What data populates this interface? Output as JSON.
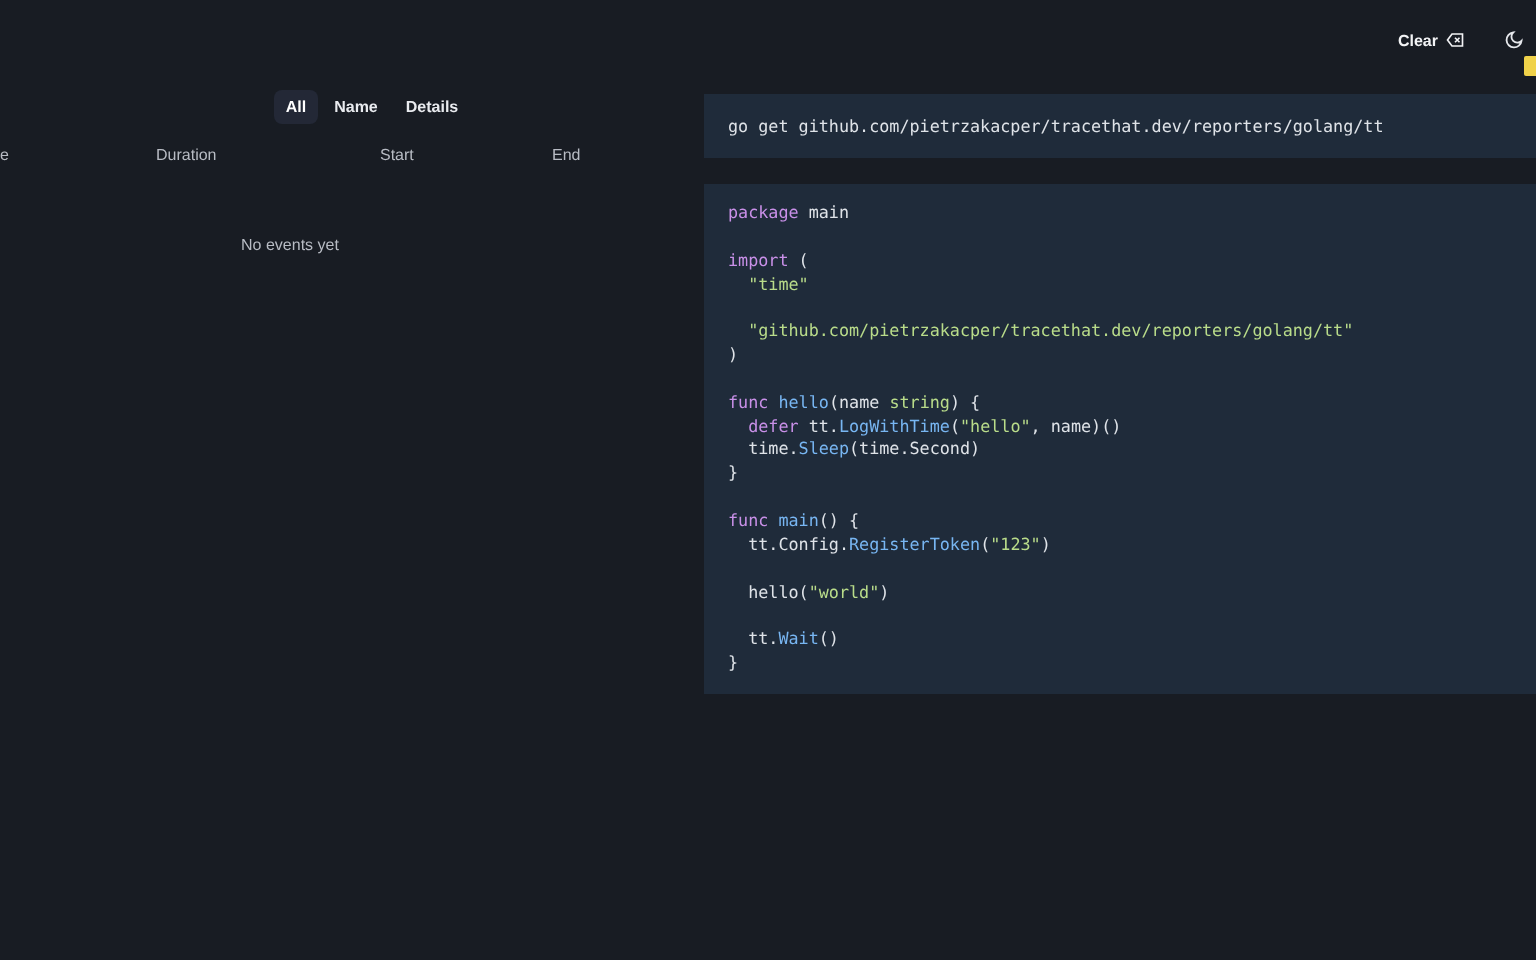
{
  "header": {
    "clear_button": "Clear"
  },
  "tabs": [
    {
      "label": "All",
      "selected": true
    },
    {
      "label": "Name",
      "selected": false
    },
    {
      "label": "Details",
      "selected": false
    }
  ],
  "table": {
    "columns": [
      "e",
      "Duration",
      "Start",
      "End"
    ],
    "empty_message": "No events yet"
  },
  "install_command": "go get github.com/pietrzakacper/tracethat.dev/reporters/golang/tt",
  "code": [
    {
      "kind": "code",
      "tokens": [
        {
          "kind": "keyword",
          "text": "package"
        },
        {
          "kind": "plain",
          "text": " main"
        }
      ]
    },
    {
      "kind": "blank"
    },
    {
      "kind": "code",
      "tokens": [
        {
          "kind": "keyword",
          "text": "import"
        },
        {
          "kind": "plain",
          "text": " ("
        }
      ]
    },
    {
      "kind": "code",
      "tokens": [
        {
          "kind": "string",
          "text": "  \"time\""
        }
      ]
    },
    {
      "kind": "blank"
    },
    {
      "kind": "code",
      "tokens": [
        {
          "kind": "string",
          "text": "  \"github.com/pietrzakacper/tracethat.dev/reporters/golang/tt\""
        }
      ]
    },
    {
      "kind": "code",
      "tokens": [
        {
          "kind": "plain",
          "text": ")"
        }
      ]
    },
    {
      "kind": "blank"
    },
    {
      "kind": "code",
      "tokens": [
        {
          "kind": "keyword",
          "text": "func "
        },
        {
          "kind": "func",
          "text": "hello"
        },
        {
          "kind": "plain",
          "text": "(name "
        },
        {
          "kind": "type",
          "text": "string"
        },
        {
          "kind": "plain",
          "text": ") {"
        }
      ]
    },
    {
      "kind": "code",
      "tokens": [
        {
          "kind": "keyword",
          "text": "  defer"
        },
        {
          "kind": "plain",
          "text": " tt."
        },
        {
          "kind": "func",
          "text": "LogWithTime"
        },
        {
          "kind": "plain",
          "text": "("
        },
        {
          "kind": "string",
          "text": "\"hello\""
        },
        {
          "kind": "plain",
          "text": ", name)()"
        }
      ]
    },
    {
      "kind": "code",
      "tokens": [
        {
          "kind": "plain",
          "text": "  time."
        },
        {
          "kind": "func",
          "text": "Sleep"
        },
        {
          "kind": "plain",
          "text": "(time.Second)"
        }
      ]
    },
    {
      "kind": "code",
      "tokens": [
        {
          "kind": "plain",
          "text": "}"
        }
      ]
    },
    {
      "kind": "blank"
    },
    {
      "kind": "code",
      "tokens": [
        {
          "kind": "keyword",
          "text": "func "
        },
        {
          "kind": "func",
          "text": "main"
        },
        {
          "kind": "plain",
          "text": "() {"
        }
      ]
    },
    {
      "kind": "code",
      "tokens": [
        {
          "kind": "plain",
          "text": "  tt.Config."
        },
        {
          "kind": "func",
          "text": "RegisterToken"
        },
        {
          "kind": "plain",
          "text": "("
        },
        {
          "kind": "string",
          "text": "\"123\""
        },
        {
          "kind": "plain",
          "text": ")"
        }
      ]
    },
    {
      "kind": "blank"
    },
    {
      "kind": "code",
      "tokens": [
        {
          "kind": "plain",
          "text": "  hello("
        },
        {
          "kind": "string",
          "text": "\"world\""
        },
        {
          "kind": "plain",
          "text": ")"
        }
      ]
    },
    {
      "kind": "blank"
    },
    {
      "kind": "code",
      "tokens": [
        {
          "kind": "plain",
          "text": "  tt."
        },
        {
          "kind": "func",
          "text": "Wait"
        },
        {
          "kind": "plain",
          "text": "()"
        }
      ]
    },
    {
      "kind": "code",
      "tokens": [
        {
          "kind": "plain",
          "text": "}"
        }
      ]
    }
  ]
}
